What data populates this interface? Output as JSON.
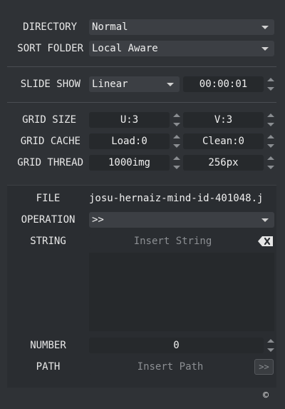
{
  "directory": {
    "label": "DIRECTORY",
    "value": "Normal"
  },
  "sort_folder": {
    "label": "SORT FOLDER",
    "value": "Local Aware"
  },
  "slide_show": {
    "label": "SLIDE SHOW",
    "mode": "Linear",
    "interval": "00:00:01"
  },
  "grid_size": {
    "label": "GRID SIZE",
    "u": "U:3",
    "v": "V:3"
  },
  "grid_cache": {
    "label": "GRID CACHE",
    "load": "Load:0",
    "clean": "Clean:0"
  },
  "grid_thread": {
    "label": "GRID THREAD",
    "images": "1000img",
    "size": "256px"
  },
  "file": {
    "label": "FILE",
    "value": "josu-hernaiz-mind-id-401048.j"
  },
  "operation": {
    "label": "OPERATION",
    "value": ">>"
  },
  "string": {
    "label": "STRING",
    "placeholder": "Insert String",
    "clear_icon": "backspace-icon"
  },
  "number": {
    "label": "NUMBER",
    "value": "0"
  },
  "path": {
    "label": "PATH",
    "placeholder": "Insert Path",
    "browse_label": ">>"
  },
  "copyright": {
    "symbol": "©"
  }
}
